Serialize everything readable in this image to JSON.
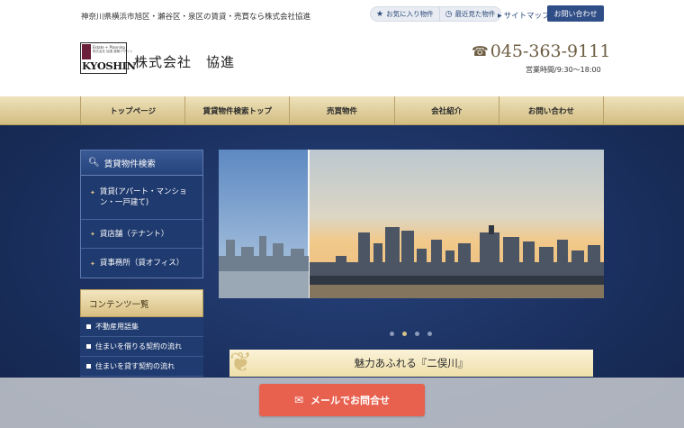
{
  "header": {
    "tagline": "神奈川県横浜市旭区・瀬谷区・泉区の賃貸・売買なら株式会社協進",
    "favorites_label": "お気に入り物件",
    "recent_label": "最近見た物件",
    "sitemap_label": "サイトマップ",
    "contact_label": "お問い合わせ",
    "company_name": "株式会社　協進",
    "logo_text": "KYOSHIN",
    "logo_small": "Estate + Planning",
    "logo_small2": "株式会社 協進 建築デザイン",
    "phone": "045-363-9111",
    "hours": "営業時間/9:30〜18:00"
  },
  "nav": {
    "items": [
      "トップページ",
      "賃貸物件検索トップ",
      "売買物件",
      "会社紹介",
      "お問い合わせ"
    ]
  },
  "sidebar": {
    "search_title": "賃貸物件検索",
    "search_items": [
      "賃貸(アパート・マンション・一戸建て)",
      "貸店舗（テナント）",
      "貸事務所（貸オフィス）"
    ],
    "contents_title": "コンテンツ一覧",
    "contents_items": [
      "不動産用語集",
      "住まいを借りる契約の流れ",
      "住まいを貸す契約の流れ"
    ]
  },
  "carousel": {
    "slide_count": 4,
    "active_index": 1
  },
  "feature": {
    "title": "魅力あふれる『二俣川』"
  },
  "footer_cta": {
    "mail_label": "メールでお問合せ"
  },
  "colors": {
    "navy": "#1a2f5e",
    "gold": "#d2bc80",
    "cta": "#e8604e"
  }
}
